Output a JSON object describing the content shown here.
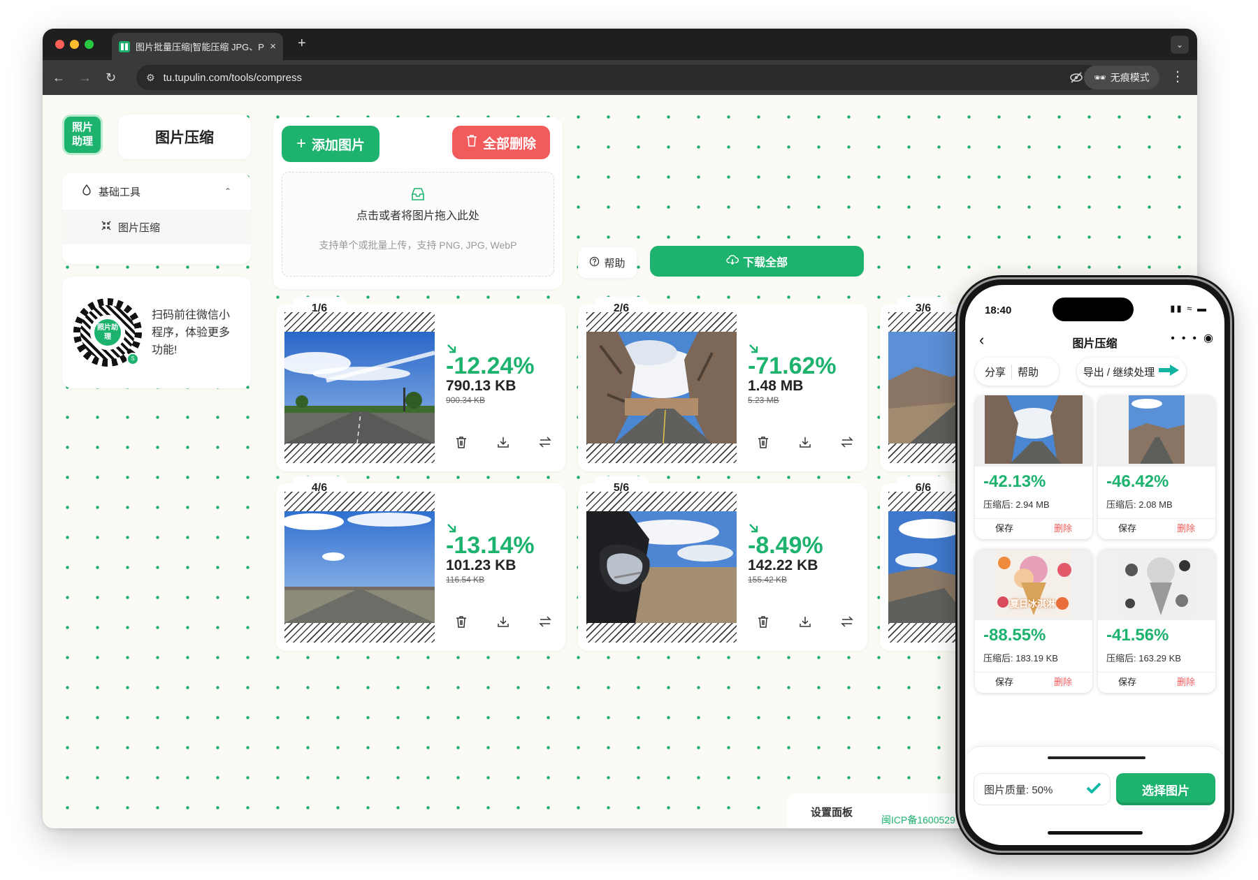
{
  "browser": {
    "tab_title": "图片批量压缩|智能压缩 JPG、P",
    "tab_close": "×",
    "new_tab": "+",
    "url": "tu.tupulin.com/tools/compress",
    "incognito_label": "无痕模式"
  },
  "sidebar": {
    "logo_text": "照片助理",
    "brand_title": "图片压缩",
    "group_label": "基础工具",
    "item_label": "图片压缩",
    "qr_text": "扫码前往微信小程序，体验更多功能!"
  },
  "upload": {
    "add_label": "添加图片",
    "delete_all_label": "全部删除",
    "drop_title": "点击或者将图片拖入此处",
    "drop_subtitle": "支持单个或批量上传，支持 PNG, JPG, WebP"
  },
  "actions": {
    "help_label": "帮助",
    "download_all_label": "下载全部"
  },
  "images": [
    {
      "index": "1/6",
      "percent": "-12.24%",
      "new_size": "790.13 KB",
      "old_size": "900.34 KB"
    },
    {
      "index": "2/6",
      "percent": "-71.62%",
      "new_size": "1.48 MB",
      "old_size": "5.23 MB"
    },
    {
      "index": "3/6"
    },
    {
      "index": "4/6",
      "percent": "-13.14%",
      "new_size": "101.23 KB",
      "old_size": "116.54 KB"
    },
    {
      "index": "5/6",
      "percent": "-8.49%",
      "new_size": "142.22 KB",
      "old_size": "155.42 KB"
    },
    {
      "index": "6/6"
    }
  ],
  "settings": {
    "title": "设置面板",
    "icp": "闽ICP备1600529"
  },
  "phone": {
    "time": "18:40",
    "title": "图片压缩",
    "share_label": "分享",
    "help_label": "帮助",
    "export_label": "导出 / 继续处理",
    "save_label": "保存",
    "delete_label": "删除",
    "cards": [
      {
        "percent": "-42.13%",
        "size": "压缩后: 2.94 MB"
      },
      {
        "percent": "-46.42%",
        "size": "压缩后: 2.08 MB"
      },
      {
        "percent": "-88.55%",
        "size": "压缩后: 183.19 KB",
        "thumb_text": "夏日冰淇淋"
      },
      {
        "percent": "-41.56%",
        "size": "压缩后: 163.29 KB"
      }
    ],
    "quality_label": "图片质量: 50%",
    "choose_label": "选择图片"
  },
  "colors": {
    "accent": "#1db36f",
    "danger": "#f15b5b",
    "page_bg": "#fbfaf4"
  }
}
